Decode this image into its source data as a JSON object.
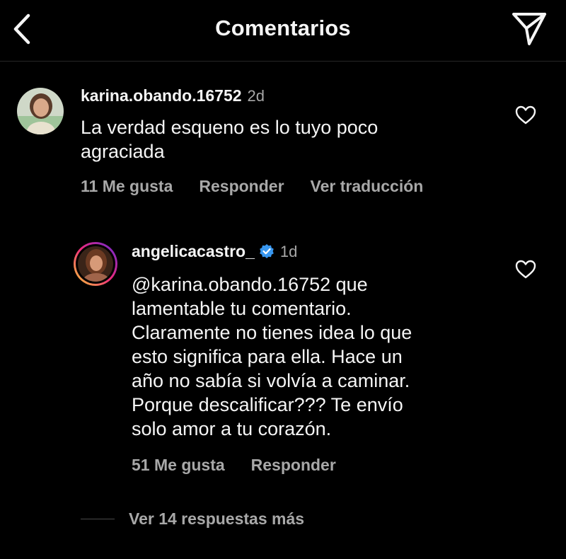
{
  "header": {
    "title": "Comentarios"
  },
  "comments": [
    {
      "username": "karina.obando.16752",
      "time": "2d",
      "text_line1": "La verdad esqueno es lo tuyo poco",
      "text_line2": "agraciada",
      "likes": "11 Me gusta",
      "reply_label": "Responder",
      "translate_label": "Ver traducción"
    },
    {
      "username": "angelicacastro_",
      "verified": true,
      "time": "1d",
      "lines": [
        "@karina.obando.16752 que",
        "lamentable tu comentario.",
        "Claramente no tienes idea lo que",
        "esto significa para ella. Hace un",
        "año no sabía si volvía a caminar.",
        "Porque descalificar??? Te envío",
        "solo amor a tu corazón."
      ],
      "likes": "51 Me gusta",
      "reply_label": "Responder"
    }
  ],
  "more_replies": "Ver 14 respuestas más",
  "colors": {
    "background": "#000000",
    "text": "#f5f5f5",
    "muted": "#a8a8a8",
    "verified": "#3897f0"
  }
}
